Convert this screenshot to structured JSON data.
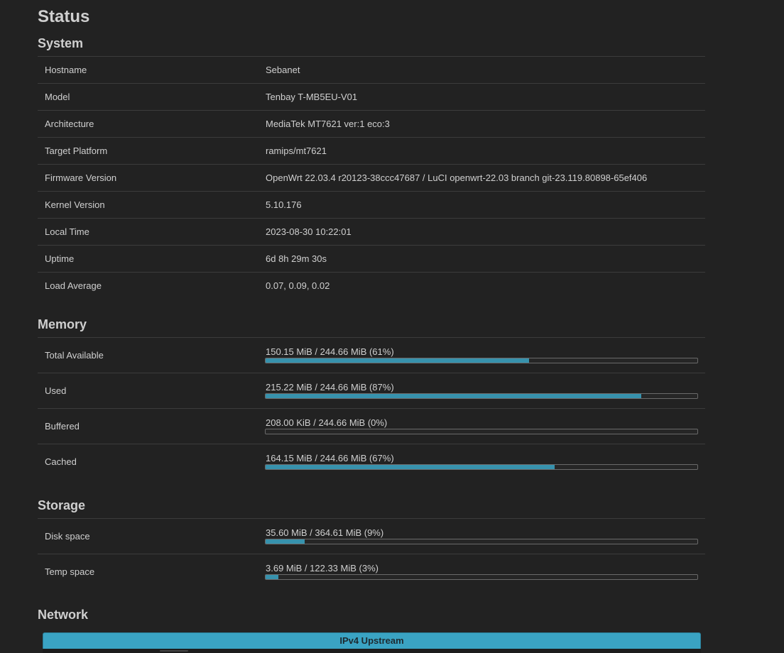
{
  "page": {
    "title": "Status"
  },
  "system": {
    "title": "System",
    "rows": [
      {
        "label": "Hostname",
        "value": "Sebanet"
      },
      {
        "label": "Model",
        "value": "Tenbay T-MB5EU-V01"
      },
      {
        "label": "Architecture",
        "value": "MediaTek MT7621 ver:1 eco:3"
      },
      {
        "label": "Target Platform",
        "value": "ramips/mt7621"
      },
      {
        "label": "Firmware Version",
        "value": "OpenWrt 22.03.4 r20123-38ccc47687 / LuCI openwrt-22.03 branch git-23.119.80898-65ef406"
      },
      {
        "label": "Kernel Version",
        "value": "5.10.176"
      },
      {
        "label": "Local Time",
        "value": "2023-08-30 10:22:01"
      },
      {
        "label": "Uptime",
        "value": "6d 8h 29m 30s"
      },
      {
        "label": "Load Average",
        "value": "0.07, 0.09, 0.02"
      }
    ]
  },
  "memory": {
    "title": "Memory",
    "rows": [
      {
        "label": "Total Available",
        "text": "150.15 MiB / 244.66 MiB (61%)",
        "percent": 61
      },
      {
        "label": "Used",
        "text": "215.22 MiB / 244.66 MiB (87%)",
        "percent": 87
      },
      {
        "label": "Buffered",
        "text": "208.00 KiB / 244.66 MiB (0%)",
        "percent": 0
      },
      {
        "label": "Cached",
        "text": "164.15 MiB / 244.66 MiB (67%)",
        "percent": 67
      }
    ]
  },
  "storage": {
    "title": "Storage",
    "rows": [
      {
        "label": "Disk space",
        "text": "35.60 MiB / 364.61 MiB (9%)",
        "percent": 9
      },
      {
        "label": "Temp space",
        "text": "3.69 MiB / 122.33 MiB (3%)",
        "percent": 3
      }
    ]
  },
  "network": {
    "title": "Network",
    "ipv4_header": "IPv4 Upstream"
  },
  "colors": {
    "background": "#222222",
    "progress": "#3792ad",
    "header_accent": "#3aa3c3"
  }
}
